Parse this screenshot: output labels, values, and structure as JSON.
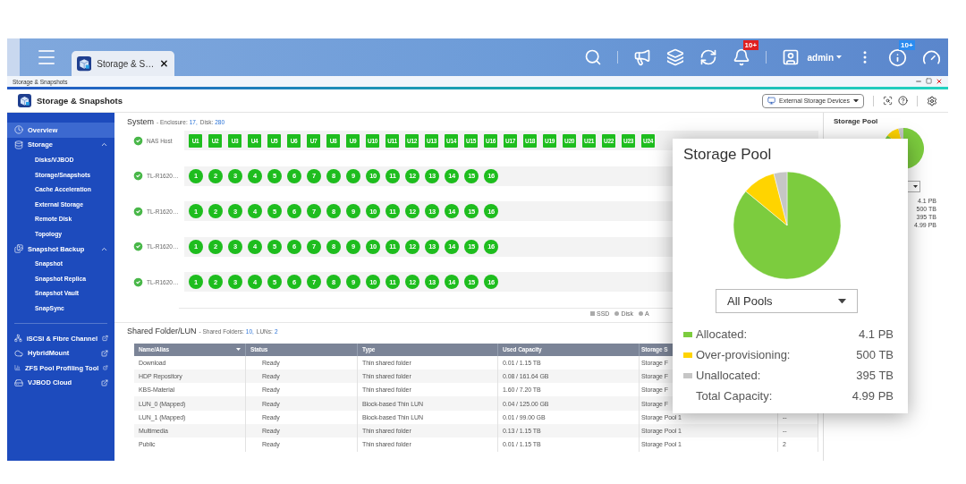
{
  "top_bar": {
    "tab": {
      "title": "Storage & S…",
      "selected": true
    },
    "notification_badge": "10+",
    "user": "admin",
    "info_badge": "10+"
  },
  "breadcrumb": "Storage & Snapshots",
  "app_header": {
    "title": "Storage & Snapshots",
    "device_dropdown": "External Storage Devices"
  },
  "sidebar": {
    "items": [
      {
        "label": "Overview",
        "selected": true
      },
      {
        "label": "Storage",
        "selected": false,
        "expanded": true,
        "children": [
          {
            "label": "Disks/VJBOD",
            "selected": false
          },
          {
            "label": "Storage/Snapshots",
            "selected": false
          },
          {
            "label": "Cache Acceleration",
            "selected": false
          },
          {
            "label": "External Storage",
            "selected": false
          },
          {
            "label": "Remote Disk",
            "selected": false
          },
          {
            "label": "Topology",
            "selected": false
          }
        ]
      },
      {
        "label": "Snapshot Backup",
        "selected": false,
        "expanded": true,
        "children": [
          {
            "label": "Snapshot",
            "selected": false
          },
          {
            "label": "Snapshot Replica",
            "selected": false
          },
          {
            "label": "Snapshot Vault",
            "selected": false
          },
          {
            "label": "SnapSync",
            "selected": false
          }
        ]
      }
    ],
    "external_links": [
      {
        "label": "iSCSI & Fibre Channel"
      },
      {
        "label": "HybridMount"
      },
      {
        "label": "ZFS Pool Profiling Tool"
      },
      {
        "label": "VJBOD Cloud"
      }
    ]
  },
  "system": {
    "title": "System",
    "summary": [
      {
        "label": "- Enclosure:",
        "value": "17,"
      },
      {
        "label": "Disk:",
        "value": "280"
      }
    ],
    "enclosures": [
      {
        "name": "NAS Host",
        "healthy": true,
        "kind": "nas",
        "bays": [
          "U1",
          "U2",
          "U3",
          "U4",
          "U5",
          "U6",
          "U7",
          "U8",
          "U9",
          "U10",
          "U11",
          "U12",
          "U13",
          "U14",
          "U15",
          "U16",
          "U17",
          "U18",
          "U19",
          "U20",
          "U21",
          "U22",
          "U23",
          "U24"
        ]
      },
      {
        "name": "TL-R1620…",
        "healthy": true,
        "kind": "jbod",
        "bays": [
          "1",
          "2",
          "3",
          "4",
          "5",
          "6",
          "7",
          "8",
          "9",
          "10",
          "11",
          "12",
          "13",
          "14",
          "15",
          "16"
        ]
      },
      {
        "name": "TL-R1620…",
        "healthy": true,
        "kind": "jbod",
        "bays": [
          "1",
          "2",
          "3",
          "4",
          "5",
          "6",
          "7",
          "8",
          "9",
          "10",
          "11",
          "12",
          "13",
          "14",
          "15",
          "16"
        ]
      },
      {
        "name": "TL-R1620…",
        "healthy": true,
        "kind": "jbod",
        "bays": [
          "1",
          "2",
          "3",
          "4",
          "5",
          "6",
          "7",
          "8",
          "9",
          "10",
          "11",
          "12",
          "13",
          "14",
          "15",
          "16"
        ]
      },
      {
        "name": "TL-R1620…",
        "healthy": true,
        "kind": "jbod",
        "bays": [
          "1",
          "2",
          "3",
          "4",
          "5",
          "6",
          "7",
          "8",
          "9",
          "10",
          "11",
          "12",
          "13",
          "14",
          "15",
          "16"
        ]
      }
    ],
    "legend": [
      {
        "label": "SSD",
        "kind": "square"
      },
      {
        "label": "Disk",
        "kind": "circle"
      },
      {
        "label": "A",
        "kind": "circle"
      }
    ]
  },
  "shared_folders": {
    "title": "Shared Folder/LUN",
    "summary": [
      {
        "label": "- Shared Folders:",
        "value": "10,"
      },
      {
        "label": "LUNs:",
        "value": "2"
      }
    ],
    "columns": [
      {
        "label": "Name/Alias",
        "sorted": true
      },
      {
        "label": "Status",
        "sorted": false
      },
      {
        "label": "Type",
        "sorted": false
      },
      {
        "label": "Used Capacity",
        "sorted": false
      },
      {
        "label": "Storage S",
        "sorted": false
      }
    ],
    "rows": [
      [
        "Download",
        "Ready",
        "Thin shared folder",
        "0.01 / 1.15 TB",
        "Storage F"
      ],
      [
        "HDP Repository",
        "Ready",
        "Thin shared folder",
        "0.08 / 161.64 GB",
        "Storage F"
      ],
      [
        "KBS-Material",
        "Ready",
        "Thin shared folder",
        "1.60 / 7.20 TB",
        "Storage F"
      ],
      [
        "LUN_0 (Mapped)",
        "Ready",
        "Block-based Thin LUN",
        "0.04 / 125.00 GB",
        "Storage F"
      ],
      [
        "LUN_1 (Mapped)",
        "Ready",
        "Block-based Thin LUN",
        "0.01 / 99.00 GB",
        "Storage Pool 1",
        "--"
      ],
      [
        "Multimedia",
        "Ready",
        "Thin shared folder",
        "0.13 / 1.15 TB",
        "Storage Pool 1",
        "--"
      ],
      [
        "Public",
        "Ready",
        "Thin shared folder",
        "0.01 / 1.15 TB",
        "Storage Pool 1",
        "2"
      ]
    ]
  },
  "storage_pool_panel": {
    "title": "Storage Pool",
    "values": [
      "4.1 PB",
      "500 TB",
      "395 TB",
      "4.99 PB"
    ]
  },
  "storage_pool_popup": {
    "title": "Storage Pool",
    "pool_select": "All Pools",
    "legend": [
      {
        "label": "Allocated:",
        "value": "4.1 PB",
        "color": "#7ccc3e"
      },
      {
        "label": "Over-provisioning:",
        "value": "500 TB",
        "color": "#ffd400"
      },
      {
        "label": "Unallocated:",
        "value": "395 TB",
        "color": "#c6c6c6"
      }
    ],
    "total": {
      "label": "Total Capacity:",
      "value": "4.99 PB"
    },
    "chart_data": {
      "type": "pie",
      "values": [
        86,
        10,
        4
      ]
    }
  }
}
